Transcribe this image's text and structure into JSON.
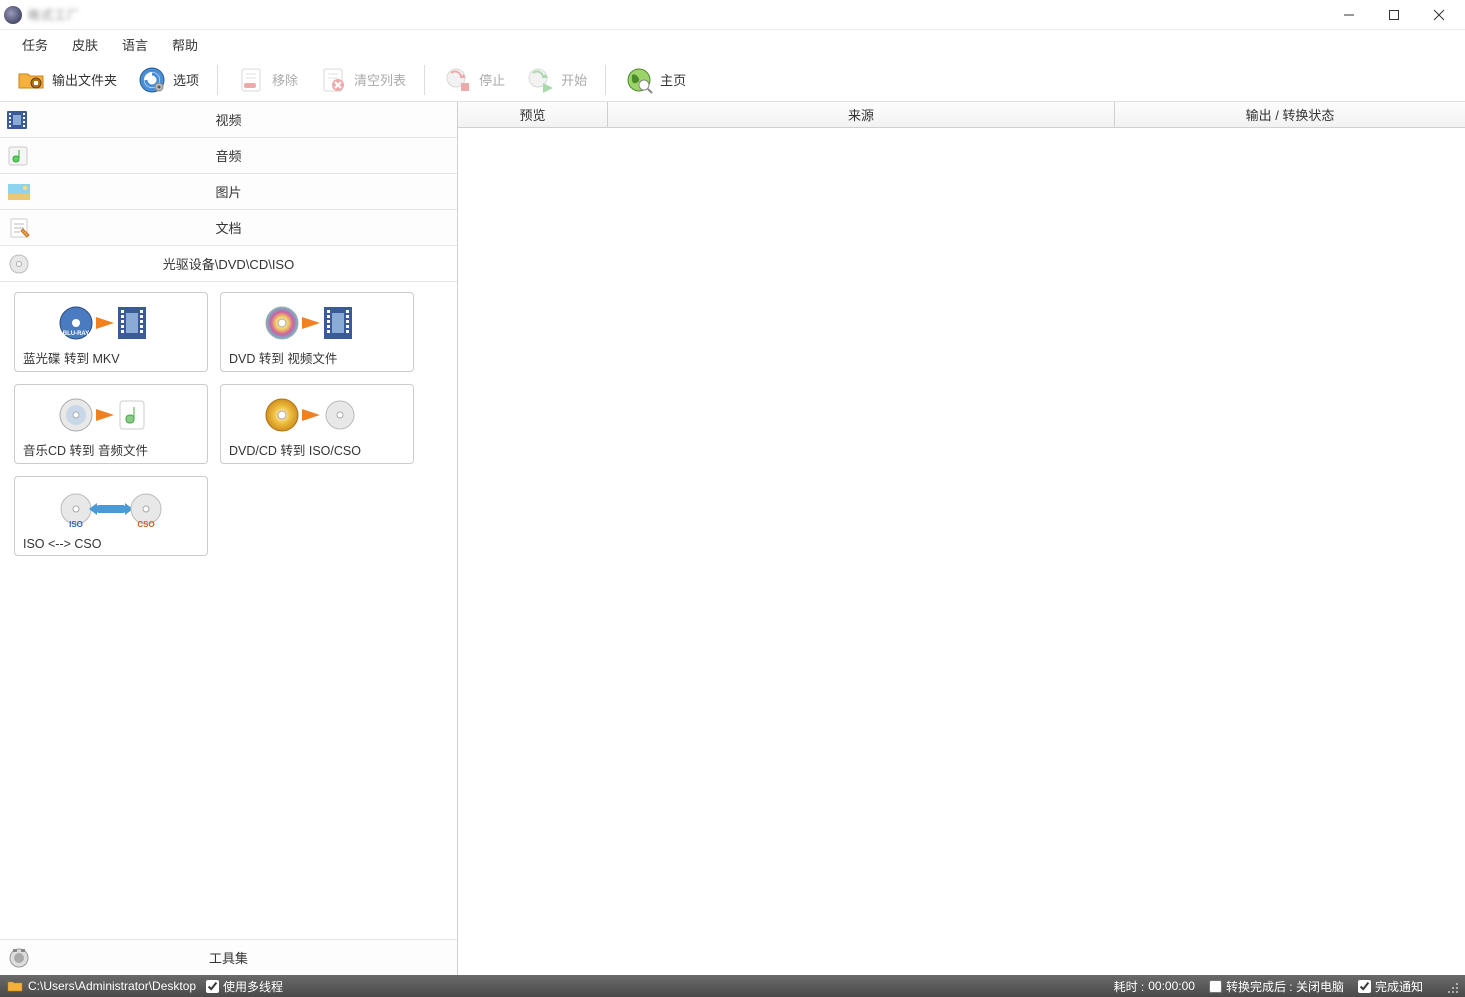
{
  "title": "格式工厂",
  "menu": {
    "task": "任务",
    "skin": "皮肤",
    "language": "语言",
    "help": "帮助"
  },
  "toolbar": {
    "output_folder": "输出文件夹",
    "options": "选项",
    "remove": "移除",
    "clear_list": "清空列表",
    "stop": "停止",
    "start": "开始",
    "home": "主页"
  },
  "categories": {
    "video": "视频",
    "audio": "音频",
    "image": "图片",
    "document": "文档",
    "disc": "光驱设备\\DVD\\CD\\ISO",
    "tools": "工具集"
  },
  "tiles": {
    "bluray_mkv": "蓝光碟 转到 MKV",
    "dvd_video": "DVD 转到 视频文件",
    "cd_audio": "音乐CD 转到 音频文件",
    "dvd_iso": "DVD/CD 转到 ISO/CSO",
    "iso_cso": "ISO <--> CSO"
  },
  "columns": {
    "preview": "预览",
    "source": "来源",
    "output": "输出 / 转换状态"
  },
  "statusbar": {
    "path": "C:\\Users\\Administrator\\Desktop",
    "multithread": "使用多线程",
    "elapsed_label": "耗时 :",
    "elapsed_time": "00:00:00",
    "after_convert": "转换完成后 : 关闭电脑",
    "complete_notify": "完成通知"
  }
}
